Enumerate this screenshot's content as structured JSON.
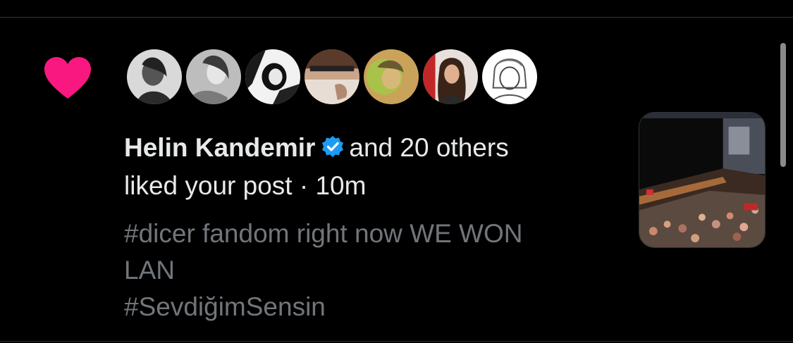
{
  "notification": {
    "actor_name": "Helin Kandemir",
    "others_text": "and 20 others",
    "action_text": "liked your post",
    "separator": "·",
    "time": "10m",
    "post_lines": [
      "#dicer fandom right now WE WON",
      "LAN",
      "#SevdiğimSensin"
    ],
    "avatar_count": 7
  },
  "icons": {
    "like": "heart-icon",
    "verified": "verified-badge-icon"
  },
  "colors": {
    "background": "#000000",
    "heart": "#f91880",
    "verified": "#1d9bf0",
    "primary_text": "#e7e9ea",
    "secondary_text": "#71767b"
  }
}
